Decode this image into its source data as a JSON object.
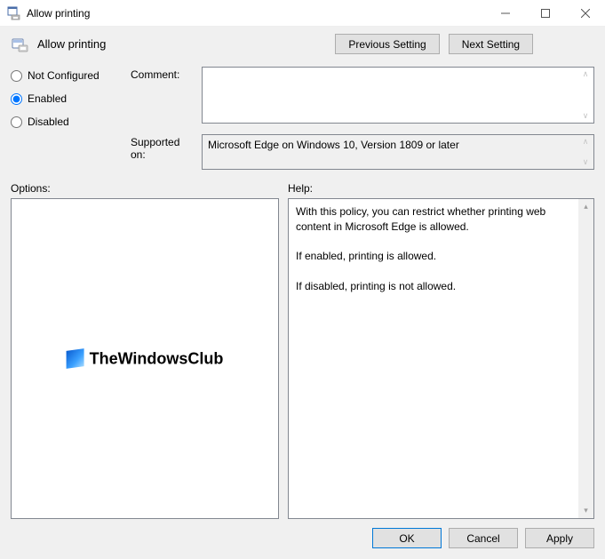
{
  "window": {
    "title": "Allow printing"
  },
  "header": {
    "setting_title": "Allow printing",
    "previous_setting": "Previous Setting",
    "next_setting": "Next Setting"
  },
  "state": {
    "not_configured": "Not Configured",
    "enabled": "Enabled",
    "disabled": "Disabled",
    "selected": "enabled"
  },
  "form": {
    "comment_label": "Comment:",
    "comment_value": "",
    "supported_label": "Supported on:",
    "supported_value": "Microsoft Edge on Windows 10, Version 1809 or later"
  },
  "lower": {
    "options_label": "Options:",
    "help_label": "Help:",
    "help_text": "With this policy, you can restrict whether printing web content in Microsoft Edge is allowed.\n\nIf enabled, printing is allowed.\n\nIf disabled, printing is not allowed."
  },
  "watermark": {
    "text": "TheWindowsClub"
  },
  "buttons": {
    "ok": "OK",
    "cancel": "Cancel",
    "apply": "Apply"
  }
}
